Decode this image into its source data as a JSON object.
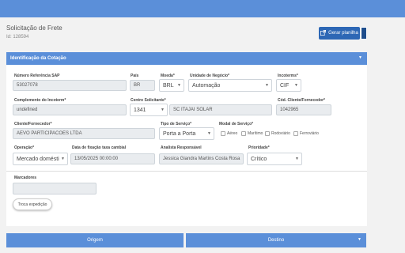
{
  "header": {
    "title": "Solicitação de Frete",
    "id_text": "Id: 128594"
  },
  "toolbar": {
    "excel_button": "Gerar planilha"
  },
  "section": {
    "title": "Identificação da Cotação"
  },
  "form": {
    "numero_ref": {
      "label": "Número Referência SAP",
      "value": "53027078"
    },
    "pais": {
      "label": "País",
      "value": "BR"
    },
    "moeda": {
      "label": "Moeda*",
      "value": "BRL"
    },
    "unidade": {
      "label": "Unidade de Negócio*",
      "value": "Automação"
    },
    "incoterms": {
      "label": "Incoterms*",
      "value": "CIF"
    },
    "complemento": {
      "label": "Complemento do Incoterm*",
      "value": "undefined"
    },
    "centro": {
      "label": "Centro Solicitante*",
      "value": "1341",
      "value2": "SC ITAJAI SOLAR"
    },
    "cod_cliente": {
      "label": "Cód. Cliente/Fornecedor*",
      "value": "1042965"
    },
    "cliente": {
      "label": "Cliente/Fornecedor*",
      "value": "AEVO PARTICIPACOES LTDA"
    },
    "tipo_servico": {
      "label": "Tipo de Serviço*",
      "value": "Porta a Porta"
    },
    "modal": {
      "label": "Modal de Serviço*",
      "options": [
        "Aéreo",
        "Marítimo",
        "Rodoviário",
        "Ferroviário"
      ]
    },
    "operacao": {
      "label": "Operação*",
      "value": "Mercado domésti"
    },
    "data_fixacao": {
      "label": "Data de fixação taxa cambial",
      "value": "13/05/2025 00:00:00"
    },
    "analista": {
      "label": "Analista Responsável",
      "value": "Jessica Giandra Martins Costa Rosa"
    },
    "prioridade": {
      "label": "Prioridade*",
      "value": "Crítico"
    },
    "marcadores": {
      "label": "Marcadores",
      "value": ""
    }
  },
  "actions": {
    "troca": "Troca expedição"
  },
  "tabs": {
    "origem": "Origem",
    "destino": "Destino"
  }
}
